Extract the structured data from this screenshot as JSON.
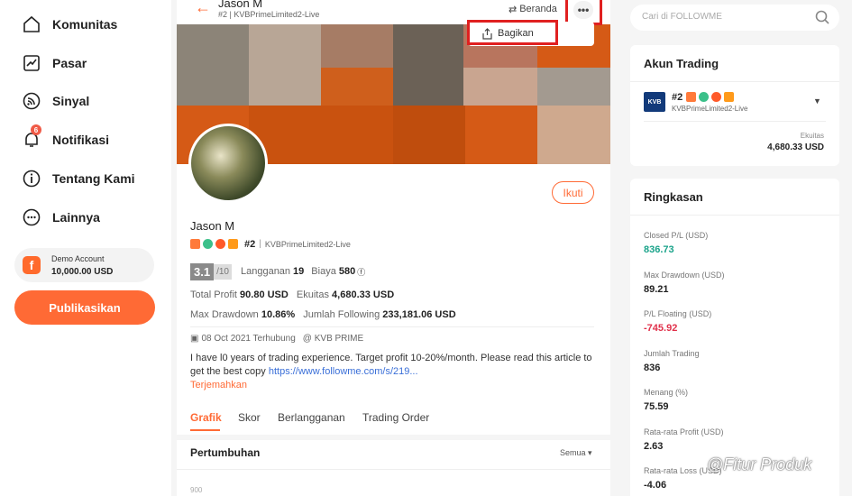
{
  "sidebar": {
    "items": [
      {
        "label": "Komunitas",
        "icon": "home-icon"
      },
      {
        "label": "Pasar",
        "icon": "chart-icon"
      },
      {
        "label": "Sinyal",
        "icon": "signal-icon"
      },
      {
        "label": "Notifikasi",
        "icon": "bell-icon",
        "badge": "6"
      },
      {
        "label": "Tentang Kami",
        "icon": "info-icon"
      },
      {
        "label": "Lainnya",
        "icon": "more-icon"
      }
    ],
    "demo_account": {
      "label": "Demo Account",
      "value": "10,000.00 USD"
    },
    "publish_label": "Publikasikan"
  },
  "header": {
    "name": "Jason M",
    "sub": "#2 | KVBPrimeLimited2-Live",
    "beranda": "Beranda",
    "share": "Bagikan"
  },
  "profile": {
    "name": "Jason M",
    "rank": "#2",
    "account": "KVBPrimeLimited2-Live",
    "follow": "Ikuti",
    "score": "3.1",
    "score_max": "/10",
    "subs_label": "Langganan",
    "subs_value": "19",
    "cost_label": "Biaya",
    "cost_value": "580",
    "total_profit_label": "Total Profit",
    "total_profit_value": "90.80 USD",
    "equity_label": "Ekuitas",
    "equity_value": "4,680.33 USD",
    "max_dd_label": "Max Drawdown",
    "max_dd_value": "10.86%",
    "following_label": "Jumlah Following",
    "following_value": "233,181.06 USD",
    "date": "08 Oct 2021 Terhubung",
    "broker": "@ KVB PRIME",
    "bio": "I have l0 years of trading experience. Target profit 10-20%/month. Please read this article to get the best copy ",
    "bio_link": "https://www.followme.com/s/219...",
    "translate": "Terjemahkan"
  },
  "tabs": [
    "Grafik",
    "Skor",
    "Berlangganan",
    "Trading Order"
  ],
  "growth": {
    "title": "Pertumbuhan",
    "filter": "Semua",
    "axis_top": "900"
  },
  "search": {
    "placeholder": "Cari di FOLLOWME"
  },
  "trading_account": {
    "title": "Akun Trading",
    "rank": "#2",
    "broker_logo": "KVB",
    "server": "KVBPrimeLimited2-Live",
    "equity_label": "Ekuitas",
    "equity_value": "4,680.33 USD"
  },
  "summary": {
    "title": "Ringkasan",
    "rows": [
      {
        "label": "Closed P/L (USD)",
        "value": "836.73",
        "color": "#1aa38a"
      },
      {
        "label": "Max Drawdown (USD)",
        "value": "89.21",
        "color": "#222222"
      },
      {
        "label": "P/L Floating (USD)",
        "value": "-745.92",
        "color": "#e0304a"
      },
      {
        "label": "Jumlah Trading",
        "value": "836",
        "color": "#222222"
      },
      {
        "label": "Menang (%)",
        "value": "75.59",
        "color": "#222222"
      },
      {
        "label": "Rata-rata Profit (USD)",
        "value": "2.63",
        "color": "#222222"
      },
      {
        "label": "Rata-rata Loss (USD)",
        "value": "-4.06",
        "color": "#222222"
      }
    ]
  },
  "watermark": "@Fitur Produk",
  "colors": {
    "accent": "#ff6a35",
    "highlight": "#e02020"
  }
}
